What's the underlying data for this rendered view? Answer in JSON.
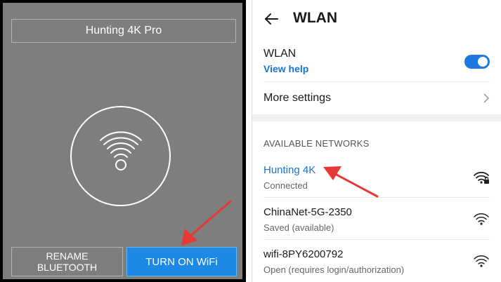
{
  "left_app": {
    "device_title": "Hunting 4K Pro",
    "rename_button_label": "RENAME\nBLUETOOTH",
    "turn_on_wifi_label": "TURN ON WiFi",
    "icons": [
      "wifi-icon",
      "red-arrow-icon"
    ],
    "colors": {
      "screen_bg": "#7e7e7e",
      "button_blue": "#1e88e5",
      "arrow_red": "#e53935"
    }
  },
  "wlan_screen": {
    "title": "WLAN",
    "wlan_toggle": {
      "label": "WLAN",
      "help_link": "View help",
      "state": "on"
    },
    "more_settings_label": "More settings",
    "available_networks_header": "AVAILABLE NETWORKS",
    "networks": [
      {
        "name": "Hunting 4K",
        "status": "Connected",
        "connected": true,
        "icon": "wifi-locked-icon"
      },
      {
        "name": "ChinaNet-5G-2350",
        "status": "Saved (available)",
        "connected": false,
        "icon": "wifi-icon"
      },
      {
        "name": "wifi-8PY6200792",
        "status": "Open (requires login/authorization)",
        "connected": false,
        "icon": "wifi-icon"
      }
    ],
    "colors": {
      "accent_blue": "#1a73d0",
      "toggle_blue": "#1f7ae0"
    }
  }
}
